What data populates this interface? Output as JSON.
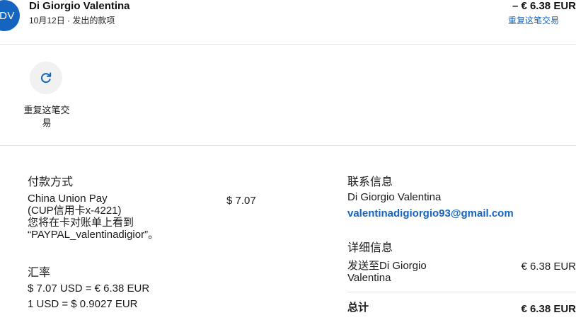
{
  "header": {
    "avatar_initials": "DV",
    "name": "Di Giorgio Valentina",
    "subline": "10月12日 · 发出的款项",
    "amount": "– € 6.38 EUR",
    "repeat_link": "重复这笔交易"
  },
  "actions": {
    "repeat_label": "重复这笔交易",
    "repeat_icon": "refresh-icon"
  },
  "payment": {
    "title": "付款方式",
    "method_line1": "China Union Pay",
    "method_line2": "(CUP信用卡x-4221)",
    "method_line3": "您将在卡对账单上看到",
    "method_line4": "“PAYPAL_valentinadigior”。",
    "amount": "$ 7.07"
  },
  "exchange": {
    "title": "汇率",
    "line1": "$ 7.07 USD = € 6.38 EUR",
    "line2": "1 USD = $ 0.9027 EUR"
  },
  "contact": {
    "title": "联系信息",
    "name": "Di Giorgio Valentina",
    "email": "valentinadigiorgio93@gmail.com"
  },
  "details": {
    "title": "详细信息",
    "sent_to_line1": "发送至Di Giorgio",
    "sent_to_line2": "Valentina",
    "sent_amount": "€ 6.38 EUR",
    "total_label": "总计",
    "total_amount": "€ 6.38 EUR"
  },
  "colors": {
    "accent": "#1565c0",
    "avatar_bg": "#1565c0",
    "divider": "#e6e6e6",
    "action_circle_bg": "#f1f1f1"
  }
}
